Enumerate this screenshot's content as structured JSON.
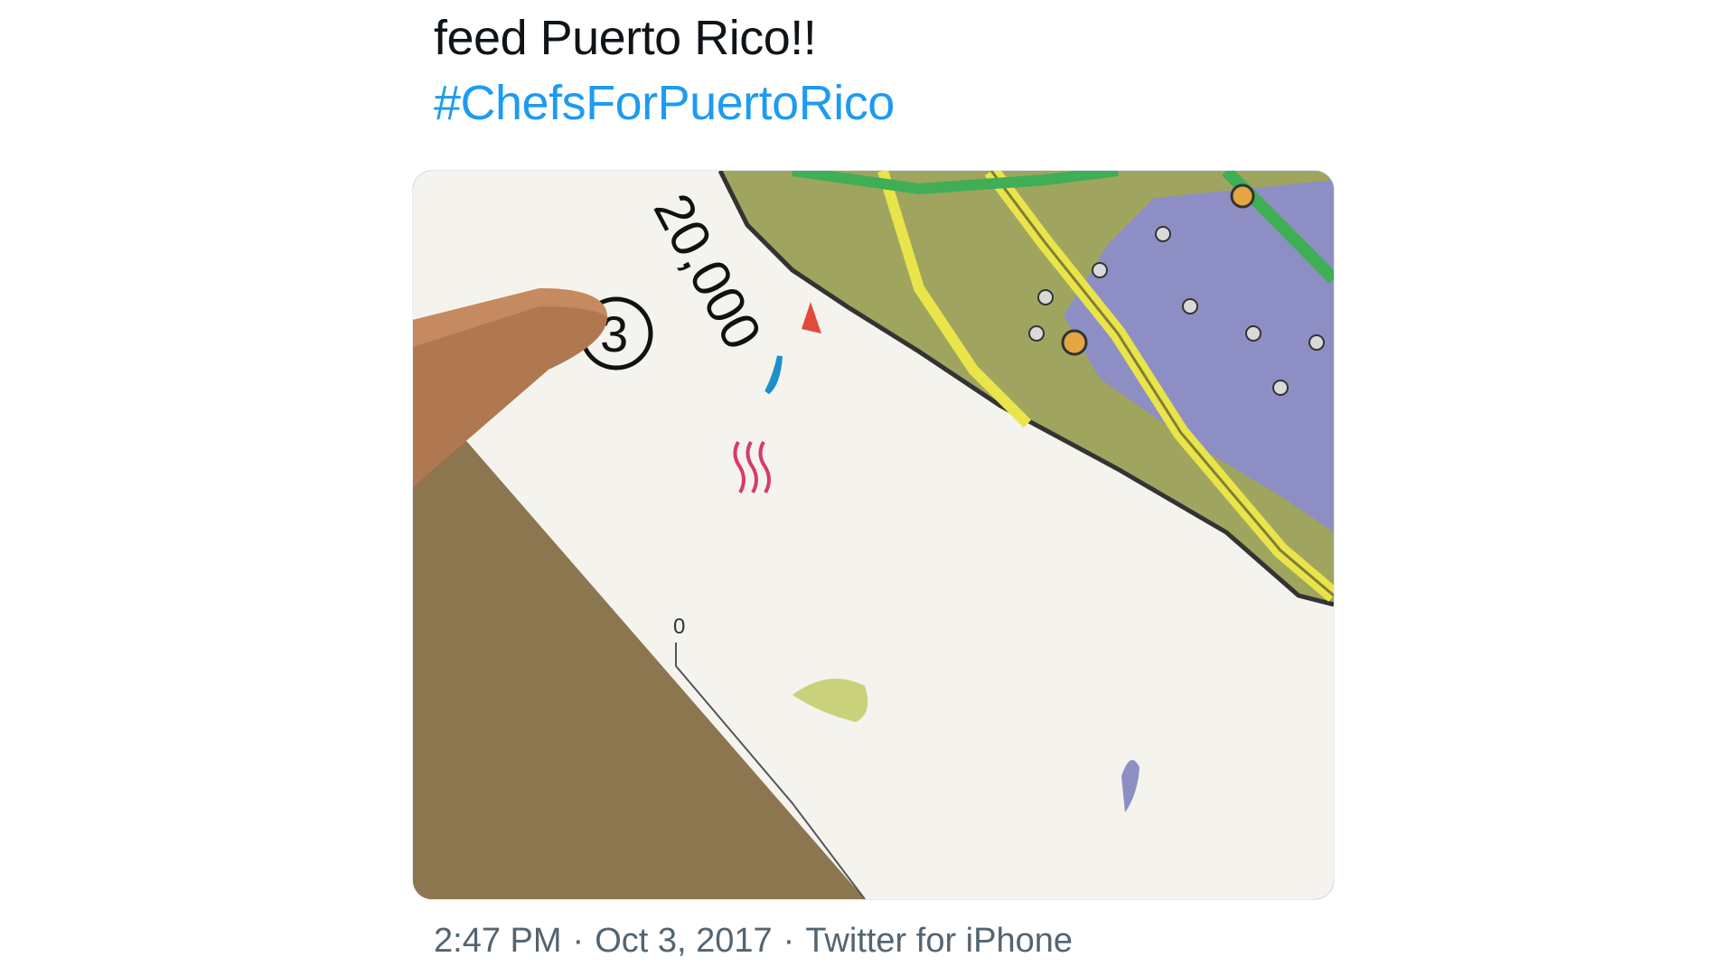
{
  "tweet": {
    "text_line": "feed Puerto Rico!!",
    "hashtag": "#ChefsForPuertoRico",
    "time": "2:47 PM",
    "date": "Oct 3, 2017",
    "source": "Twitter for iPhone",
    "separator": "·"
  },
  "media": {
    "map_scale_label": "20,000",
    "circled_number": "3",
    "scale_zero": "0"
  },
  "colors": {
    "hashtag": "#1d9bf0",
    "meta": "#536471",
    "text": "#0f1419",
    "land": "#a8ad6a",
    "water_region": "#8d8fc4",
    "road": "#e9e44a",
    "road_green": "#3fae55"
  }
}
